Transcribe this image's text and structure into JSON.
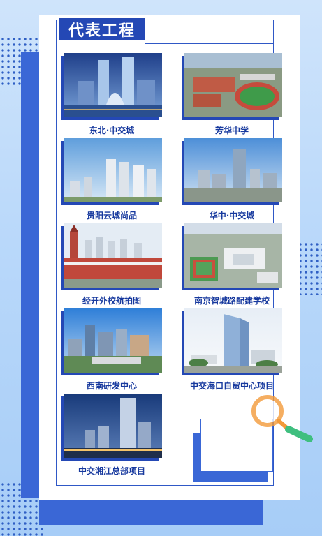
{
  "section_title": "代表工程",
  "projects": [
    {
      "caption": "东北·中交城",
      "scene": "twin-towers"
    },
    {
      "caption": "芳华中学",
      "scene": "school-field"
    },
    {
      "caption": "贵阳云城尚品",
      "scene": "residential"
    },
    {
      "caption": "华中·中交城",
      "scene": "city-aerial"
    },
    {
      "caption": "经开外校航拍图",
      "scene": "campus-clocktower"
    },
    {
      "caption": "南京智城路配建学校",
      "scene": "school-aerial"
    },
    {
      "caption": "西南研发中心",
      "scene": "office-park"
    },
    {
      "caption": "中交海口自贸中心项目",
      "scene": "glass-tower"
    },
    {
      "caption": "中交湘江总部项目",
      "scene": "night-tower"
    }
  ],
  "colors": {
    "primary": "#2448b5",
    "accent": "#3a67d6",
    "caption": "#17399e",
    "magnifier_ring": "#f39a3a",
    "magnifier_handle": "#3fbf7f"
  }
}
